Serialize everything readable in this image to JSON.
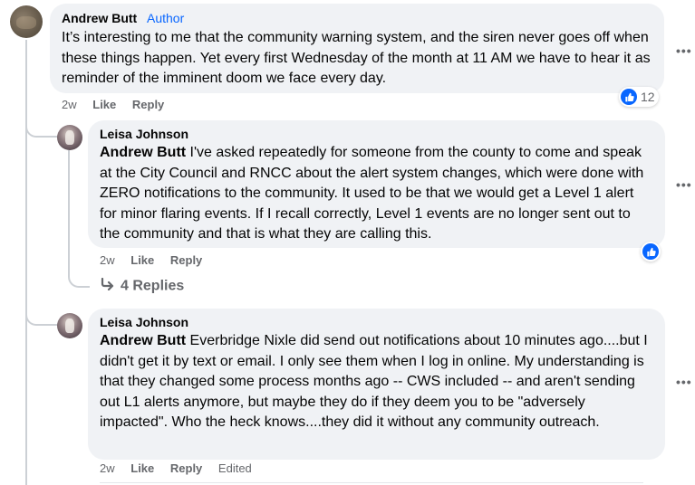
{
  "comments": [
    {
      "author": "Andrew Butt",
      "badge": "Author",
      "text": "It’s interesting to me that the community warning system, and the siren never goes off when these things happen. Yet every first Wednesday of the month at 11 AM we have to hear it as reminder of the imminent doom we face every day.",
      "time": "2w",
      "like_label": "Like",
      "reply_label": "Reply",
      "reactions": {
        "type": "like",
        "count": "12"
      }
    },
    {
      "author": "Leisa Johnson",
      "mention": "Andrew Butt",
      "text": " I've asked repeatedly for someone from the county to come and speak at the City Council and RNCC about the alert system changes, which were done with ZERO notifications to the community. It used to be that we would get a Level 1 alert for minor flaring events. If I recall correctly, Level 1 events are no longer sent out to the community and that is what they are calling this.",
      "time": "2w",
      "like_label": "Like",
      "reply_label": "Reply",
      "reactions": {
        "type": "like",
        "count": ""
      }
    },
    {
      "author": "Leisa Johnson",
      "mention": "Andrew Butt",
      "text": " Everbridge Nixle did send out notifications about 10 minutes ago....but I didn't get it by text or email. I only see them when I log in online. My understanding is that they changed some process months ago -- CWS included -- and aren't sending out L1 alerts anymore, but maybe they do if they deem you to be \"adversely impacted\". Who the heck knows....they did it without any community outreach.",
      "time": "2w",
      "like_label": "Like",
      "reply_label": "Reply",
      "edited_label": "Edited"
    }
  ],
  "view_replies": {
    "label": "4 Replies",
    "icon": "reply-arrow-icon"
  },
  "more_glyph": "•••",
  "colors": {
    "accent": "#0866ff",
    "bubble": "#f0f2f5",
    "meta": "#65676b"
  }
}
